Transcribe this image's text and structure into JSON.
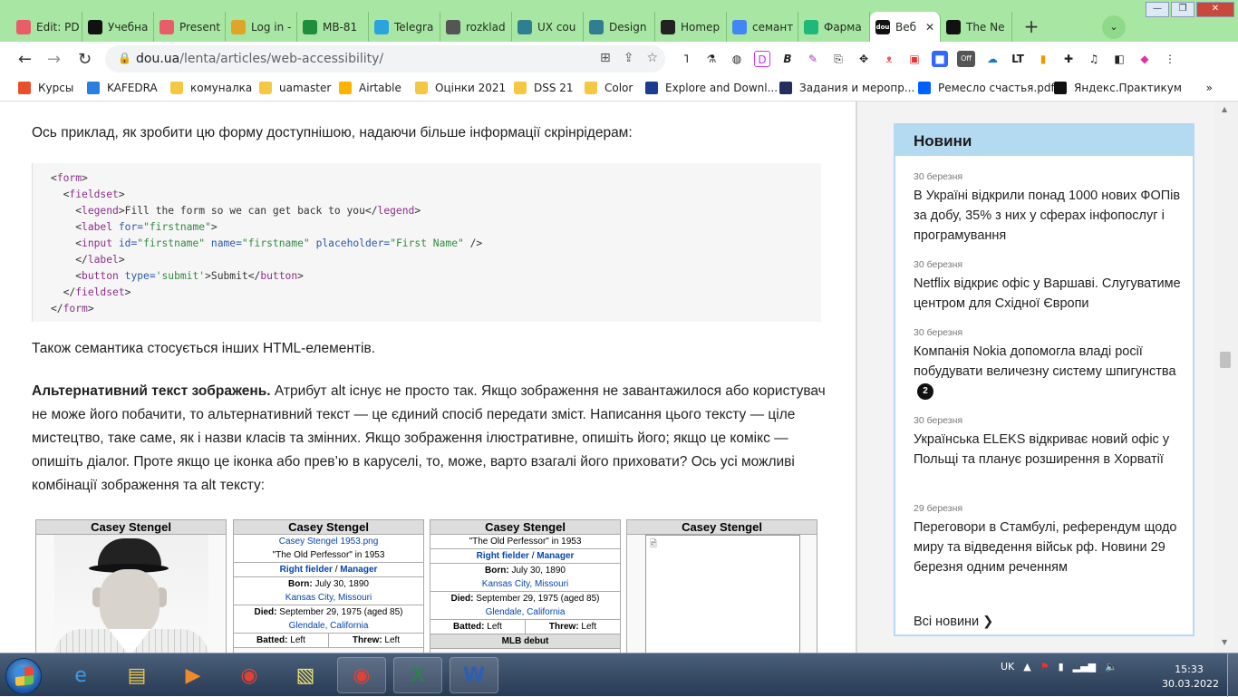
{
  "browser": {
    "tabs": [
      {
        "label": "Edit: PD",
        "icon": "s-icon",
        "color": "#e85d6a"
      },
      {
        "label": "Учебна",
        "icon": "qr-icon",
        "color": "#111111"
      },
      {
        "label": "Present",
        "icon": "s-icon",
        "color": "#e85d6a"
      },
      {
        "label": "Log in -",
        "icon": "chrome-icon",
        "color": "#e0a526"
      },
      {
        "label": "MB-81",
        "icon": "sheets-icon",
        "color": "#1e8e3e"
      },
      {
        "label": "Telegra",
        "icon": "telegram-icon",
        "color": "#2aa3de"
      },
      {
        "label": "rozklad",
        "icon": "globe-icon",
        "color": "#555555"
      },
      {
        "label": "UX cou",
        "icon": "book-icon",
        "color": "#2f7f91"
      },
      {
        "label": "Design",
        "icon": "book-icon",
        "color": "#2f7f91"
      },
      {
        "label": "Homep",
        "icon": "github-icon",
        "color": "#222222"
      },
      {
        "label": "семант",
        "icon": "google-icon",
        "color": "#4285f4"
      },
      {
        "label": "Фарма",
        "icon": "c-icon",
        "color": "#1db87a"
      },
      {
        "label": "Веб",
        "icon": "dou-icon",
        "color": "#111111",
        "active": true
      },
      {
        "label": "The Ne",
        "icon": "nyt-icon",
        "color": "#111111"
      }
    ],
    "dou_favicon_text": "dou",
    "url_host": "dou.ua",
    "url_path": "/lenta/articles/web-accessibility/",
    "extensions_badge": "Off",
    "bookmarks": [
      {
        "label": "Курсы",
        "icon": "ms-icon"
      },
      {
        "label": "KAFEDRA",
        "icon": "bracket-icon"
      },
      {
        "label": "комуналка",
        "icon": "folder-icon"
      },
      {
        "label": "uamaster",
        "icon": "folder-icon"
      },
      {
        "label": "Airtable",
        "icon": "airtable-icon"
      },
      {
        "label": "Оцінки 2021",
        "icon": "folder-icon"
      },
      {
        "label": "DSS 21",
        "icon": "folder-icon"
      },
      {
        "label": "Color",
        "icon": "folder-icon"
      },
      {
        "label": "Explore and Downl...",
        "icon": "infinity-icon"
      },
      {
        "label": "Задания и меропр...",
        "icon": "p-icon"
      },
      {
        "label": "Ремесло счастья.pdf",
        "icon": "dropbox-icon"
      },
      {
        "label": "Яндекс.Практикум",
        "icon": "yandex-icon"
      }
    ]
  },
  "article": {
    "intro": "Ось приклад, як зробити цю форму доступнішою, надаючи більше інформації скрінрідерам:",
    "code": {
      "l1_open": "<",
      "l1_tag": "form",
      "l1_close": ">",
      "l2_tag": "fieldset",
      "l3_tag": "legend",
      "l3_text": "Fill the form so we can get back to you",
      "l3_end": "legend",
      "l4_tag": "label",
      "l4_attr": "for=",
      "l4_val": "\"firstname\"",
      "l5_tag": "input",
      "l5_attr1": "id=",
      "l5_val1": "\"firstname\"",
      "l5_attr2": "name=",
      "l5_val2": "\"firstname\"",
      "l5_attr3": "placeholder=",
      "l5_val3": "\"First Name\"",
      "l6_tag": "label",
      "l7_tag": "button",
      "l7_attr": "type=",
      "l7_val": "'submit'",
      "l7_text": "Submit",
      "l7_end": "button",
      "l8_tag": "fieldset",
      "l9_tag": "form"
    },
    "semantics_line": "Також семантика стосується інших HTML-елементів.",
    "alt_heading": "Альтернативний текст зображень.",
    "alt_body": " Атрибут alt існує не просто так. Якщо зображення не завантажилося або користувач не може його побачити, то альтернативний текст — це єдиний спосіб передати зміст. Написання цього тексту — ціле мистецтво, таке саме, як і назви класів та змінних. Якщо зображення ілюстративне, опишіть його; якщо це комікс — опишіть діалог. Проте якщо це іконка або прев’ю в каруселі, то, може, варто взагалі його приховати? Ось усі можливі комбінації зображення та alt тексту:"
  },
  "wiki": {
    "title": "Casey Stengel",
    "file": "Casey Stengel 1953.png",
    "nickname": "\"The Old Perfessor\" in 1953",
    "pos1": "Right fielder",
    "sep": " / ",
    "pos2": "Manager",
    "born_label": "Born:",
    "born_date": " July 30, 1890",
    "born_place": "Kansas City, Missouri",
    "died_label": "Died:",
    "died_date": " September 29, 1975 (aged 85)",
    "died_place": "Glendale, California",
    "batted": "Batted: Left",
    "threw": "Threw: Left",
    "batted_label": "Batted:",
    "threw_label": "Threw:",
    "side": " Left",
    "debut": "MLB debut"
  },
  "news": {
    "header": "Новини",
    "items": [
      {
        "date": "30 березня",
        "text": "В Україні відкрили понад 1000 нових ФОПів за добу, 35% з них у сферах інфопослуг і програмування"
      },
      {
        "date": "30 березня",
        "text": "Netflix відкриє офіс у Варшаві. Слугуватиме центром для Східної Європи"
      },
      {
        "date": "30 березня",
        "text": "Компанія Nokia допомогла владі росії побудувати величезну систему шпигунства",
        "badge": "2"
      },
      {
        "date": "30 березня",
        "text": "Українська ELEKS відкриває новий офіс у Польщі та планує розширення в Хорватії"
      },
      {
        "date": "29 березня",
        "text": "Переговори в Стамбулі, референдум щодо миру та відведення військ рф. Новини 29 березня одним реченням"
      }
    ],
    "all": "Всі новини ❯"
  },
  "taskbar": {
    "lang": "UK",
    "time": "15:33",
    "date": "30.03.2022"
  }
}
